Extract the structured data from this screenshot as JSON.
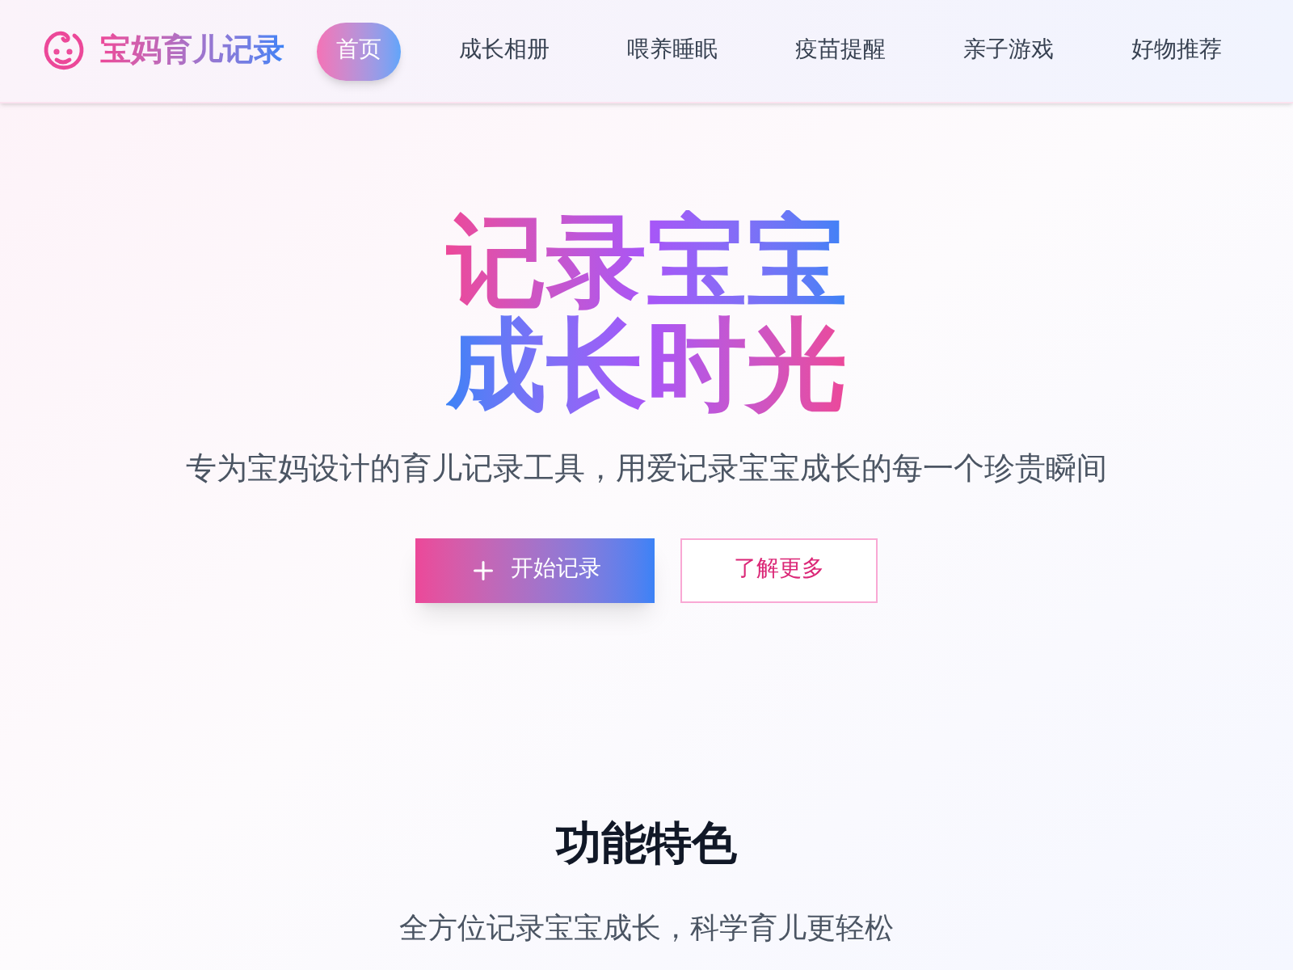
{
  "brand": {
    "name": "宝妈育儿记录"
  },
  "nav": [
    {
      "label": "首页",
      "selected": true
    },
    {
      "label": "成长相册",
      "selected": false
    },
    {
      "label": "喂养睡眠",
      "selected": false
    },
    {
      "label": "疫苗提醒",
      "selected": false
    },
    {
      "label": "亲子游戏",
      "selected": false
    },
    {
      "label": "好物推荐",
      "selected": false
    }
  ],
  "hero": {
    "title_lines": [
      "记录宝宝",
      "成长时光"
    ],
    "subtitle": "专为宝妈设计的育儿记录工具，用爱记录宝宝成长的每一个珍贵瞬间",
    "primary_button": "开始记录",
    "secondary_button": "了解更多"
  },
  "features": {
    "title": "功能特色",
    "subtitle": "全方位记录宝宝成长，科学育儿更轻松"
  }
}
